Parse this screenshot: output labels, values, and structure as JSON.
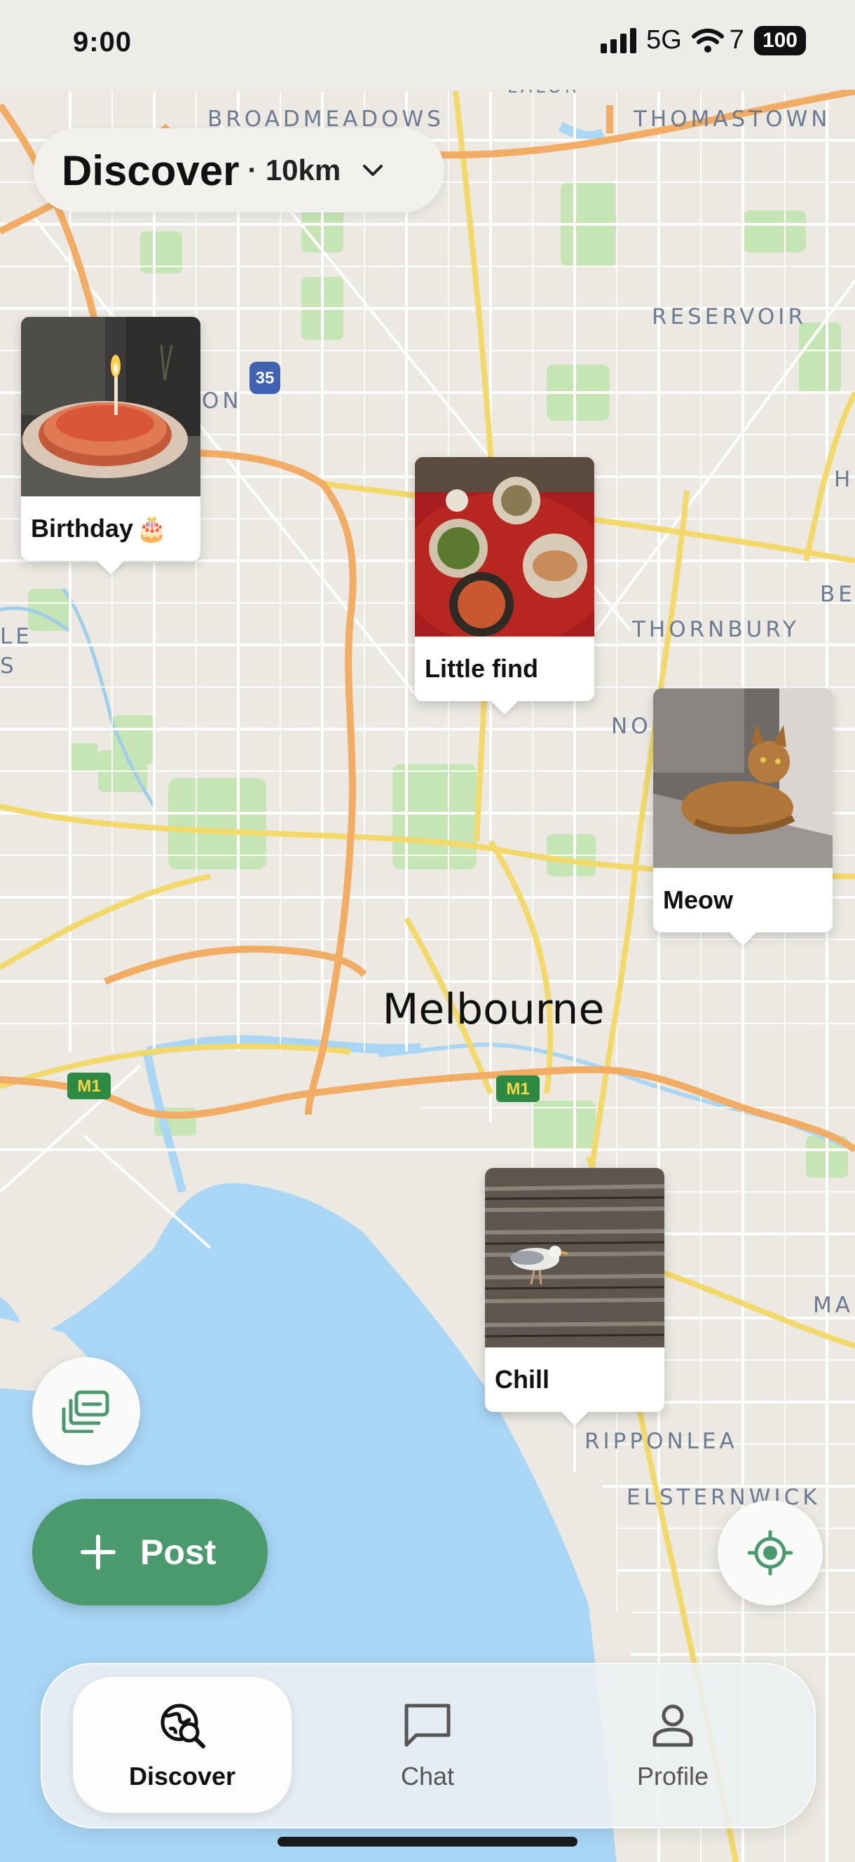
{
  "status_bar": {
    "time": "9:00",
    "network": "5G",
    "wifi_count": "7",
    "battery": "100"
  },
  "header": {
    "title": "Discover",
    "separator": "·",
    "radius": "10km",
    "chevron_icon": "chevron-down-icon"
  },
  "map": {
    "city": "Melbourne",
    "suburbs": [
      "BROADMEADOWS",
      "THOMASTOWN",
      "RESERVOIR",
      "THORNBURY",
      "RIPPONLEA",
      "ELSTERNWICK"
    ],
    "partial_labels": [
      "ON",
      "H",
      "BE",
      "LE",
      "S",
      "NO",
      "MA",
      "LALOR"
    ],
    "road_shields": [
      "35",
      "M1",
      "M1"
    ]
  },
  "pins": [
    {
      "label": "Birthday",
      "emoji": "🎂"
    },
    {
      "label": "Little find"
    },
    {
      "label": "Meow"
    },
    {
      "label": "Chill"
    }
  ],
  "controls": {
    "gallery_icon": "gallery-stack-icon",
    "post_label": "Post",
    "locate_icon": "locate-icon"
  },
  "tabs": [
    {
      "label": "Discover",
      "icon": "globe-search-icon",
      "active": true
    },
    {
      "label": "Chat",
      "icon": "chat-bubble-icon",
      "active": false
    },
    {
      "label": "Profile",
      "icon": "person-icon",
      "active": false
    }
  ],
  "colors": {
    "accent": "#4a9a6e",
    "water": "#a9d6f5",
    "land": "#ece9e3",
    "motorway": "#f2ac63",
    "main_road": "#f3d86a"
  }
}
